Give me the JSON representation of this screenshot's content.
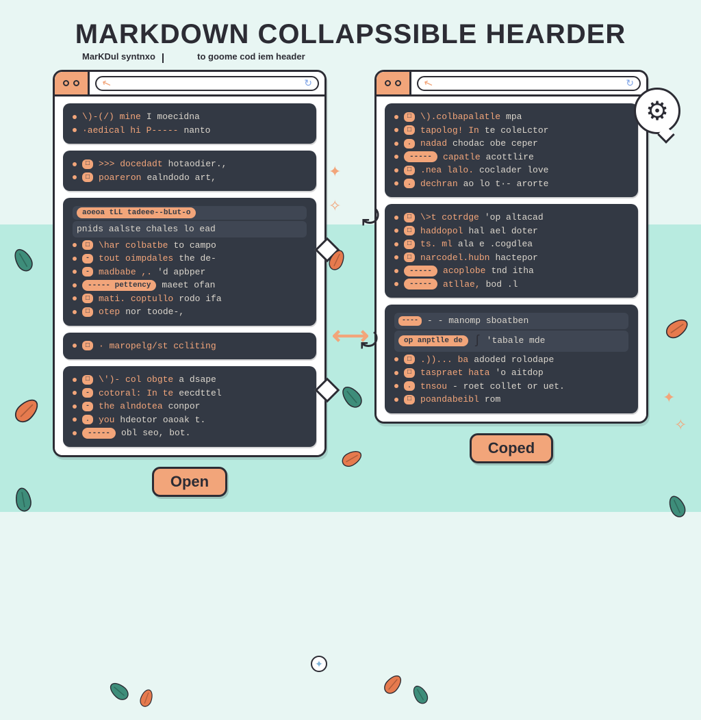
{
  "title": "MaRKDOWn COLLaPSSIBLE HeaRDER",
  "subtitle1": "MarKDul syntnxo",
  "subtitle2": "to goome cod iem header",
  "gear_icon_name": "gear-icon",
  "left": {
    "button": "Open",
    "blocks": [
      {
        "lines": [
          {
            "type": "bul",
            "o": "\\)-(/) mine",
            "d": " I moecidna"
          },
          {
            "type": "bul",
            "o": "·aedical hi  P-----",
            "d": "  nanto"
          }
        ]
      },
      {
        "lines": [
          {
            "type": "bul",
            "pill": "□",
            "o": ">>> docedadt",
            "d": " hotaodier.,"
          },
          {
            "type": "bul",
            "pill": "□",
            "o": " poareron",
            "d": " ealndodo  art,"
          }
        ]
      },
      {
        "lines": [
          {
            "type": "hl",
            "pill": "aoeoa tLL tadeee--bLut-o"
          },
          {
            "type": "hl",
            "d": "pnids aalste chales lo  ead"
          },
          {
            "type": "bul",
            "pill": "□",
            "o": "\\har colbatbe",
            "d": " to  campo"
          },
          {
            "type": "bul",
            "pill": "-",
            "o": " tout oimpdales",
            "d": " the  de-"
          },
          {
            "type": "bul",
            "pill": "-",
            "o": " madbabe ,.",
            "d": " 'd  apbper"
          },
          {
            "type": "bul",
            "pill": "----- pettency",
            "d": "  maeet ofan"
          },
          {
            "type": "bul",
            "pill": "□",
            "o": " mati.  coptullo",
            "d": "  rodo ifa"
          },
          {
            "type": "bul",
            "pill": "□",
            "o": " otep",
            "d": " nor  toode-,"
          }
        ]
      },
      {
        "lines": [
          {
            "type": "bul",
            "pill": "□",
            "o": "· maropelg/st  ccliting"
          }
        ]
      },
      {
        "lines": [
          {
            "type": "bul",
            "pill": "□",
            "o": "\\')- col obgte",
            "d": " a  dsape"
          },
          {
            "type": "bul",
            "pill": "-",
            "o": " cotoral: In te",
            "d": "  eecdttel"
          },
          {
            "type": "bul",
            "pill": "-",
            "o": "the  alndotea",
            "d": "    conpor"
          },
          {
            "type": "bul",
            "pill": ".",
            "o": "you",
            "d": "    hdeotor oaoak   t."
          },
          {
            "type": "bul",
            "pill": "-----",
            "d": "  obl seo, bot."
          }
        ]
      }
    ]
  },
  "right": {
    "button": "Coped",
    "blocks": [
      {
        "lines": [
          {
            "type": "bul",
            "pill": "□",
            "o": "\\).colbapalatle",
            "d": " mpa"
          },
          {
            "type": "bul",
            "pill": "□",
            "o": " tapolog! In",
            "d": " te  coleLctor"
          },
          {
            "type": "bul",
            "pill": ".",
            "o": " nadad",
            "d": " chodac  obe  ceper"
          },
          {
            "type": "bul",
            "pill": "-----",
            "o": "  capatle",
            "d": "  acottlire"
          },
          {
            "type": "bul",
            "pill": "□",
            "o": " .nea lalo.",
            "d": " coclader   love"
          },
          {
            "type": "bul",
            "pill": ".",
            "o": " dechran",
            "d": "  ao lo t·- arorte"
          }
        ]
      },
      {
        "lines": [
          {
            "type": "bul",
            "pill": "□",
            "o": " \\>t cotrdge",
            "d": " 'op  altacad"
          },
          {
            "type": "bul",
            "pill": "□",
            "o": " haddopol",
            "d": " hal ael  doter"
          },
          {
            "type": "bul",
            "pill": "□",
            "o": "ts.  ml",
            "d": "  ala e  .cogdlea"
          },
          {
            "type": "bul",
            "pill": "□",
            "o": " narcodel.hubn",
            "d": "   hactepor"
          },
          {
            "type": "bul",
            "pill": "-----",
            "o": "  acoplobe",
            "d": "  tnd itha"
          },
          {
            "type": "bul",
            "pill": "-----",
            "o": "  atllae,",
            "d": " bod .l"
          }
        ]
      },
      {
        "lines": [
          {
            "type": "hl",
            "pill": "----",
            "d": "  - -  manomp  sboatben"
          },
          {
            "type": "hl",
            "pill": "op  anptlle de",
            "curl": true,
            "d": " 'tabale  mde"
          },
          {
            "type": "bul",
            "pill": "□",
            "o": " .))... ba",
            "d": "  adoded  rolodape"
          },
          {
            "type": "bul",
            "pill": "□",
            "o": " taspraet hata",
            "d": "    'o aitdop"
          },
          {
            "type": "bul",
            "pill": ".",
            "o": "tnsou",
            "d": "  -  roet  collet or  uet."
          },
          {
            "type": "bul",
            "pill": "□",
            "o": " poandabeibl",
            "d": "  rom"
          }
        ]
      }
    ]
  }
}
